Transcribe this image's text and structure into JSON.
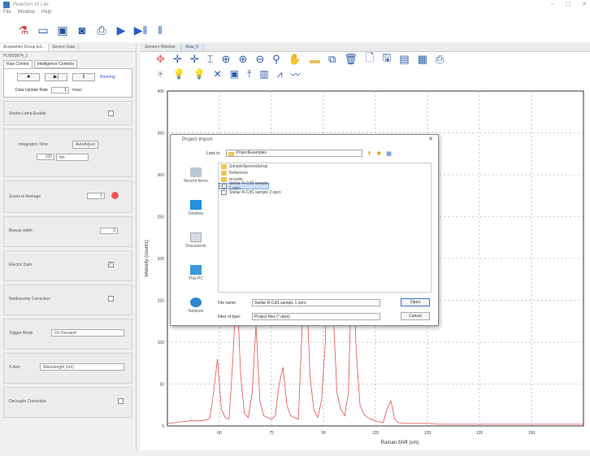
{
  "window": {
    "title": "PeakSim 10 Lite"
  },
  "menu": [
    "File",
    "Window",
    "Help"
  ],
  "left_panel": {
    "tabs": [
      "Acquisition Group Ed...",
      "Sensor Data"
    ],
    "device": "PLMS0874_1",
    "subtabs": [
      "Raw Control",
      "Intelligence Controls"
    ],
    "controls": {
      "stop": "■",
      "step": "▶|",
      "pause": "‖",
      "status": "Running"
    },
    "update_label": "Data Update Rate",
    "update_value": "1",
    "update_unit": "msec",
    "items": [
      {
        "label": "Strobe Lamp Enable",
        "checked": false
      },
      {
        "label": "Integration Time",
        "button": "AutoAdjust",
        "value": "100",
        "unit": "ms"
      },
      {
        "label": "Scans to Average",
        "value": "1"
      },
      {
        "label": "Boxcar width",
        "value": "0"
      },
      {
        "label": "Electric Dark",
        "checked": true
      },
      {
        "label": "Nonlinearity Correction",
        "checked": false
      },
      {
        "label": "Trigger Mode",
        "select": "On Demand"
      },
      {
        "label": "X Axis",
        "select": "Wavelength (nm)"
      },
      {
        "label": "Decouple Correction",
        "checked": false
      }
    ]
  },
  "right_panel": {
    "tabs": [
      "Sensors Window",
      "Raw_0"
    ],
    "chart_data": {
      "type": "line",
      "xlabel": "Raman Shift (cm)",
      "ylabel": "Intensity (counts)",
      "xticks": [
        "60",
        "75",
        "90",
        "105",
        "120",
        "135",
        "150"
      ],
      "yticks": [
        "400",
        "350",
        "300",
        "250",
        "200",
        "150",
        "100",
        "50",
        "0"
      ],
      "color": "#e05050",
      "x": [
        0,
        10,
        20,
        30,
        40,
        50,
        55,
        60,
        65,
        70,
        75,
        80,
        85,
        90,
        95,
        100,
        105,
        110,
        115,
        120,
        125,
        130,
        135,
        140,
        145,
        150,
        155,
        160,
        165,
        170,
        175,
        180,
        185,
        190,
        195,
        200,
        205,
        210,
        215,
        220,
        225,
        230,
        235,
        240,
        245,
        250,
        255,
        260,
        265,
        270,
        275,
        280,
        285,
        290,
        295,
        300,
        310,
        320,
        330,
        340,
        350,
        360,
        380,
        400,
        420,
        440,
        460,
        480,
        500,
        520,
        540
      ],
      "y": [
        3,
        4,
        5,
        6,
        6,
        7,
        9,
        40,
        80,
        20,
        10,
        8,
        80,
        175,
        60,
        15,
        10,
        40,
        120,
        30,
        12,
        10,
        8,
        12,
        50,
        70,
        25,
        12,
        10,
        8,
        120,
        180,
        60,
        20,
        10,
        30,
        100,
        320,
        140,
        40,
        20,
        12,
        40,
        220,
        90,
        25,
        14,
        10,
        8,
        6,
        5,
        4,
        20,
        30,
        8,
        4,
        3,
        3,
        3,
        3,
        2,
        2,
        2,
        2,
        2,
        2,
        2,
        2,
        2,
        2,
        2
      ]
    }
  },
  "dialog": {
    "title": "Project Import",
    "look_in_label": "Look in:",
    "look_in_value": "ProjectExamples",
    "places": [
      "Recent Items",
      "Desktop",
      "Documents",
      "This PC",
      "Network"
    ],
    "files": [
      "SampleSpectraSetup",
      "Reference",
      "records",
      "Stellar R-CdS sample 1.opro",
      "Stellar R-CdS sample 2.opro"
    ],
    "selected_index": 3,
    "filename_label": "File name:",
    "filename_value": "Stellar R-CdS sample 1.opro",
    "filetype_label": "Files of type:",
    "filetype_value": "Project files (*.opro)",
    "open_label": "Open",
    "cancel_label": "Cancel"
  }
}
